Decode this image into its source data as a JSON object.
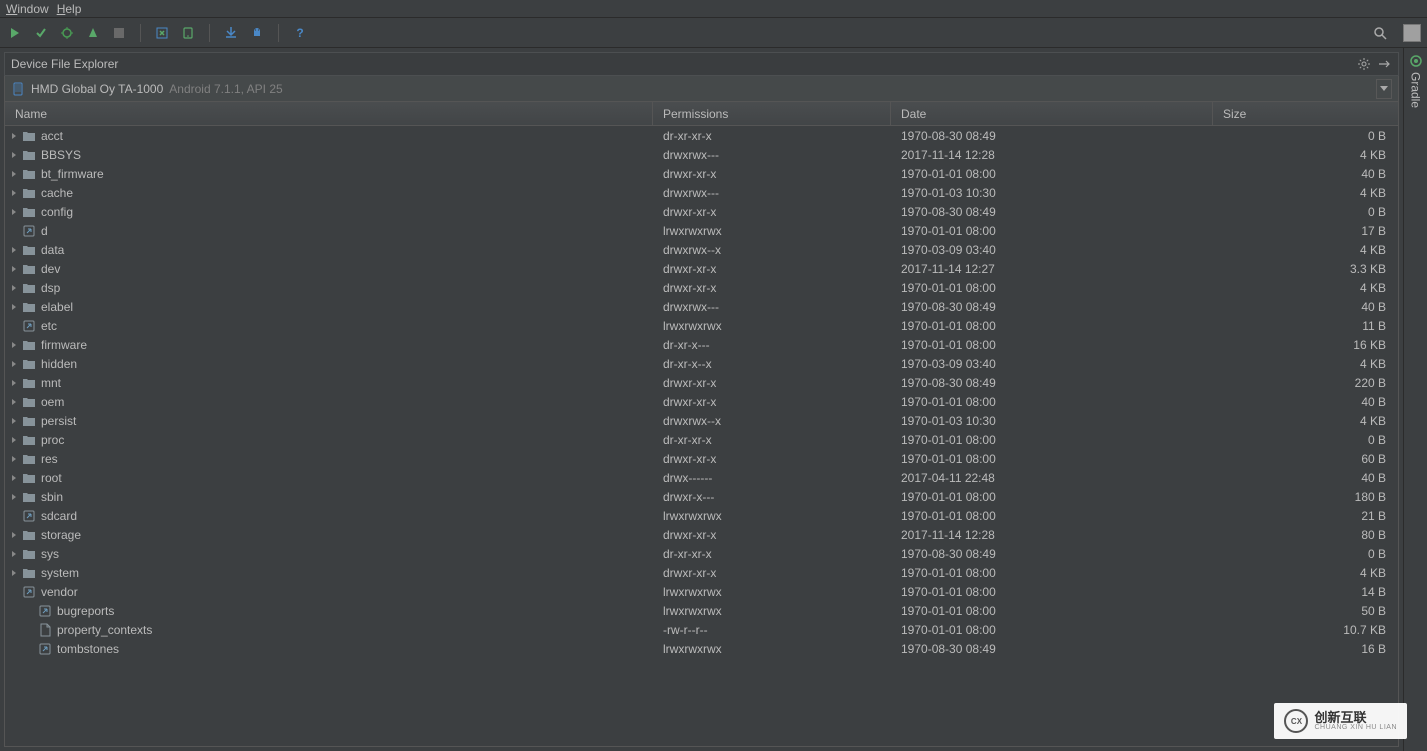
{
  "menu": {
    "window": "Window",
    "help": "Help"
  },
  "panel": {
    "title": "Device File Explorer"
  },
  "device": {
    "name": "HMD Global Oy TA-1000",
    "info": "Android 7.1.1, API 25"
  },
  "columns": {
    "name": "Name",
    "permissions": "Permissions",
    "date": "Date",
    "size": "Size"
  },
  "sidebar": {
    "gradle": "Gradle"
  },
  "watermark": {
    "cn": "创新互联",
    "en": "CHUANG XIN HU LIAN"
  },
  "rows": [
    {
      "type": "folder",
      "name": "acct",
      "perm": "dr-xr-xr-x",
      "date": "1970-08-30 08:49",
      "size": "0 B",
      "expandable": true,
      "indent": 0
    },
    {
      "type": "folder",
      "name": "BBSYS",
      "perm": "drwxrwx---",
      "date": "2017-11-14 12:28",
      "size": "4 KB",
      "expandable": true,
      "indent": 0
    },
    {
      "type": "folder",
      "name": "bt_firmware",
      "perm": "drwxr-xr-x",
      "date": "1970-01-01 08:00",
      "size": "40 B",
      "expandable": true,
      "indent": 0
    },
    {
      "type": "folder",
      "name": "cache",
      "perm": "drwxrwx---",
      "date": "1970-01-03 10:30",
      "size": "4 KB",
      "expandable": true,
      "indent": 0
    },
    {
      "type": "folder",
      "name": "config",
      "perm": "drwxr-xr-x",
      "date": "1970-08-30 08:49",
      "size": "0 B",
      "expandable": true,
      "indent": 0
    },
    {
      "type": "file",
      "name": "d",
      "perm": "lrwxrwxrwx",
      "date": "1970-01-01 08:00",
      "size": "17 B",
      "expandable": false,
      "indent": 0,
      "filetype": "link"
    },
    {
      "type": "folder",
      "name": "data",
      "perm": "drwxrwx--x",
      "date": "1970-03-09 03:40",
      "size": "4 KB",
      "expandable": true,
      "indent": 0
    },
    {
      "type": "folder",
      "name": "dev",
      "perm": "drwxr-xr-x",
      "date": "2017-11-14 12:27",
      "size": "3.3 KB",
      "expandable": true,
      "indent": 0
    },
    {
      "type": "folder",
      "name": "dsp",
      "perm": "drwxr-xr-x",
      "date": "1970-01-01 08:00",
      "size": "4 KB",
      "expandable": true,
      "indent": 0
    },
    {
      "type": "folder",
      "name": "elabel",
      "perm": "drwxrwx---",
      "date": "1970-08-30 08:49",
      "size": "40 B",
      "expandable": true,
      "indent": 0
    },
    {
      "type": "file",
      "name": "etc",
      "perm": "lrwxrwxrwx",
      "date": "1970-01-01 08:00",
      "size": "11 B",
      "expandable": false,
      "indent": 0,
      "filetype": "link"
    },
    {
      "type": "folder",
      "name": "firmware",
      "perm": "dr-xr-x---",
      "date": "1970-01-01 08:00",
      "size": "16 KB",
      "expandable": true,
      "indent": 0
    },
    {
      "type": "folder",
      "name": "hidden",
      "perm": "dr-xr-x--x",
      "date": "1970-03-09 03:40",
      "size": "4 KB",
      "expandable": true,
      "indent": 0
    },
    {
      "type": "folder",
      "name": "mnt",
      "perm": "drwxr-xr-x",
      "date": "1970-08-30 08:49",
      "size": "220 B",
      "expandable": true,
      "indent": 0
    },
    {
      "type": "folder",
      "name": "oem",
      "perm": "drwxr-xr-x",
      "date": "1970-01-01 08:00",
      "size": "40 B",
      "expandable": true,
      "indent": 0
    },
    {
      "type": "folder",
      "name": "persist",
      "perm": "drwxrwx--x",
      "date": "1970-01-03 10:30",
      "size": "4 KB",
      "expandable": true,
      "indent": 0
    },
    {
      "type": "folder",
      "name": "proc",
      "perm": "dr-xr-xr-x",
      "date": "1970-01-01 08:00",
      "size": "0 B",
      "expandable": true,
      "indent": 0
    },
    {
      "type": "folder",
      "name": "res",
      "perm": "drwxr-xr-x",
      "date": "1970-01-01 08:00",
      "size": "60 B",
      "expandable": true,
      "indent": 0
    },
    {
      "type": "folder",
      "name": "root",
      "perm": "drwx------",
      "date": "2017-04-11 22:48",
      "size": "40 B",
      "expandable": true,
      "indent": 0
    },
    {
      "type": "folder",
      "name": "sbin",
      "perm": "drwxr-x---",
      "date": "1970-01-01 08:00",
      "size": "180 B",
      "expandable": true,
      "indent": 0
    },
    {
      "type": "file",
      "name": "sdcard",
      "perm": "lrwxrwxrwx",
      "date": "1970-01-01 08:00",
      "size": "21 B",
      "expandable": false,
      "indent": 0,
      "filetype": "link"
    },
    {
      "type": "folder",
      "name": "storage",
      "perm": "drwxr-xr-x",
      "date": "2017-11-14 12:28",
      "size": "80 B",
      "expandable": true,
      "indent": 0
    },
    {
      "type": "folder",
      "name": "sys",
      "perm": "dr-xr-xr-x",
      "date": "1970-08-30 08:49",
      "size": "0 B",
      "expandable": true,
      "indent": 0
    },
    {
      "type": "folder",
      "name": "system",
      "perm": "drwxr-xr-x",
      "date": "1970-01-01 08:00",
      "size": "4 KB",
      "expandable": true,
      "indent": 0
    },
    {
      "type": "file",
      "name": "vendor",
      "perm": "lrwxrwxrwx",
      "date": "1970-01-01 08:00",
      "size": "14 B",
      "expandable": false,
      "indent": 0,
      "filetype": "link"
    },
    {
      "type": "file",
      "name": "bugreports",
      "perm": "lrwxrwxrwx",
      "date": "1970-01-01 08:00",
      "size": "50 B",
      "expandable": false,
      "indent": 1,
      "filetype": "link"
    },
    {
      "type": "file",
      "name": "property_contexts",
      "perm": "-rw-r--r--",
      "date": "1970-01-01 08:00",
      "size": "10.7 KB",
      "expandable": false,
      "indent": 1,
      "filetype": "file"
    },
    {
      "type": "file",
      "name": "tombstones",
      "perm": "lrwxrwxrwx",
      "date": "1970-08-30 08:49",
      "size": "16 B",
      "expandable": false,
      "indent": 1,
      "filetype": "link"
    }
  ]
}
